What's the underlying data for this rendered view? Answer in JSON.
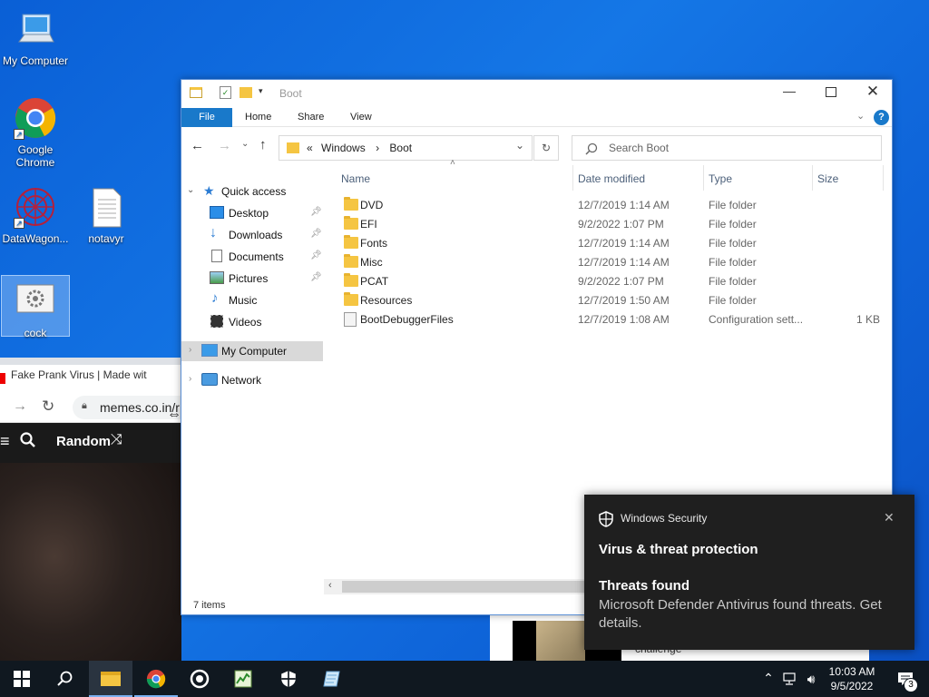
{
  "desktop": {
    "icons": [
      {
        "label": "My Computer",
        "icon": "computer-icon"
      },
      {
        "label": "Google Chrome",
        "icon": "chrome-icon"
      },
      {
        "label": "DataWagon...",
        "icon": "datawagon-icon"
      },
      {
        "label": "notavyr",
        "icon": "text-file-icon"
      },
      {
        "label": "cock",
        "icon": "settings-file-icon"
      }
    ]
  },
  "browser": {
    "tab_title": "Fake Prank Virus | Made wit",
    "url": "memes.co.in/r",
    "site_nav_label": "Random"
  },
  "explorer": {
    "title": "Boot",
    "ribbon": {
      "file": "File",
      "home": "Home",
      "share": "Share",
      "view": "View"
    },
    "address": {
      "chevron": "«",
      "crumb1": "Windows",
      "sep": "›",
      "crumb2": "Boot"
    },
    "search_placeholder": "Search Boot",
    "nav": {
      "quick_access": "Quick access",
      "desktop": "Desktop",
      "downloads": "Downloads",
      "documents": "Documents",
      "pictures": "Pictures",
      "music": "Music",
      "videos": "Videos",
      "my_computer": "My Computer",
      "network": "Network"
    },
    "columns": {
      "name": "Name",
      "date": "Date modified",
      "type": "Type",
      "size": "Size"
    },
    "files": [
      {
        "name": "DVD",
        "date": "12/7/2019 1:14 AM",
        "type": "File folder",
        "size": ""
      },
      {
        "name": "EFI",
        "date": "9/2/2022 1:07 PM",
        "type": "File folder",
        "size": ""
      },
      {
        "name": "Fonts",
        "date": "12/7/2019 1:14 AM",
        "type": "File folder",
        "size": ""
      },
      {
        "name": "Misc",
        "date": "12/7/2019 1:14 AM",
        "type": "File folder",
        "size": ""
      },
      {
        "name": "PCAT",
        "date": "9/2/2022 1:07 PM",
        "type": "File folder",
        "size": ""
      },
      {
        "name": "Resources",
        "date": "12/7/2019 1:50 AM",
        "type": "File folder",
        "size": ""
      },
      {
        "name": "BootDebuggerFiles",
        "date": "12/7/2019 1:08 AM",
        "type": "Configuration sett...",
        "size": "1 KB"
      }
    ],
    "status": "7 items"
  },
  "toast": {
    "app": "Windows Security",
    "title": "Virus & threat protection",
    "heading": "Threats found",
    "body": "Microsoft Defender Antivirus found threats. Get details."
  },
  "behind_text": "challenge",
  "taskbar": {
    "time": "10:03 AM",
    "date": "9/5/2022",
    "notification_count": "3"
  },
  "colors": {
    "desktop_bg": "#1577e6",
    "file_tab": "#1979ca",
    "taskbar": "#101820",
    "toast_bg": "#1f1f1f"
  }
}
